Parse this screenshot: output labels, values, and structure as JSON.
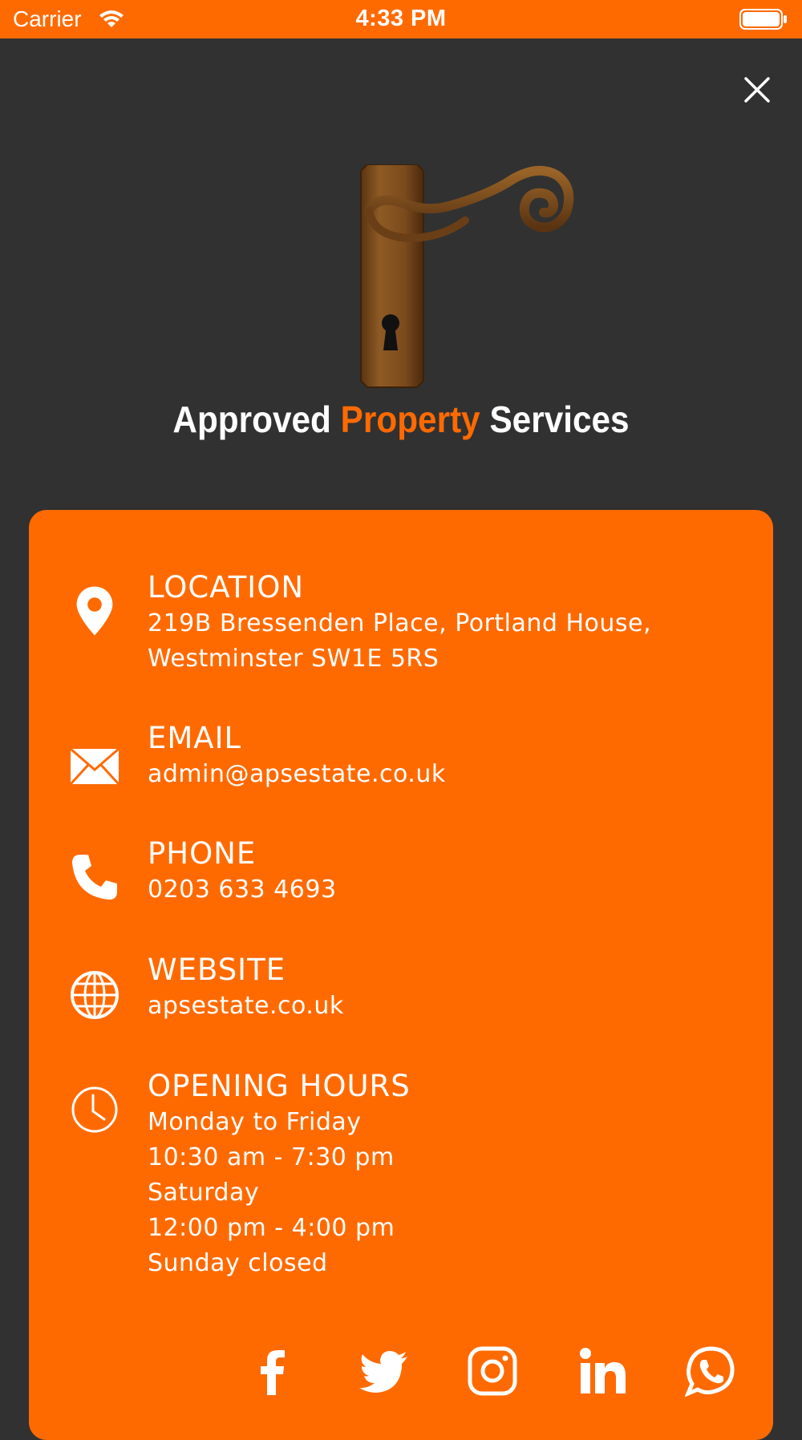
{
  "status_bar": {
    "carrier": "Carrier",
    "time": "4:33 PM"
  },
  "brand": {
    "part1": "Approved",
    "part2": "Property",
    "part3": "Services",
    "accent_color": "#ff6a00"
  },
  "contact": {
    "location": {
      "title": "LOCATION",
      "lines": [
        "219B Bressenden Place, Portland House,",
        "Westminster SW1E 5RS"
      ],
      "icon": "map-pin-icon"
    },
    "email": {
      "title": "EMAIL",
      "value": "admin@apsestate.co.uk",
      "icon": "envelope-icon"
    },
    "phone": {
      "title": "PHONE",
      "value": "0203 633 4693",
      "icon": "phone-icon"
    },
    "website": {
      "title": "WEBSITE",
      "value": "apsestate.co.uk",
      "icon": "globe-icon"
    },
    "hours": {
      "title": "OPENING HOURS",
      "lines": [
        "Monday to Friday",
        "10:30 am - 7:30 pm",
        "Saturday",
        "12:00 pm - 4:00 pm",
        "Sunday closed"
      ],
      "icon": "clock-icon"
    }
  },
  "socials": [
    "facebook-icon",
    "twitter-icon",
    "instagram-icon",
    "linkedin-icon",
    "whatsapp-icon"
  ],
  "colors": {
    "background": "#313131",
    "card": "#ff6a00",
    "text": "#ffffff"
  }
}
